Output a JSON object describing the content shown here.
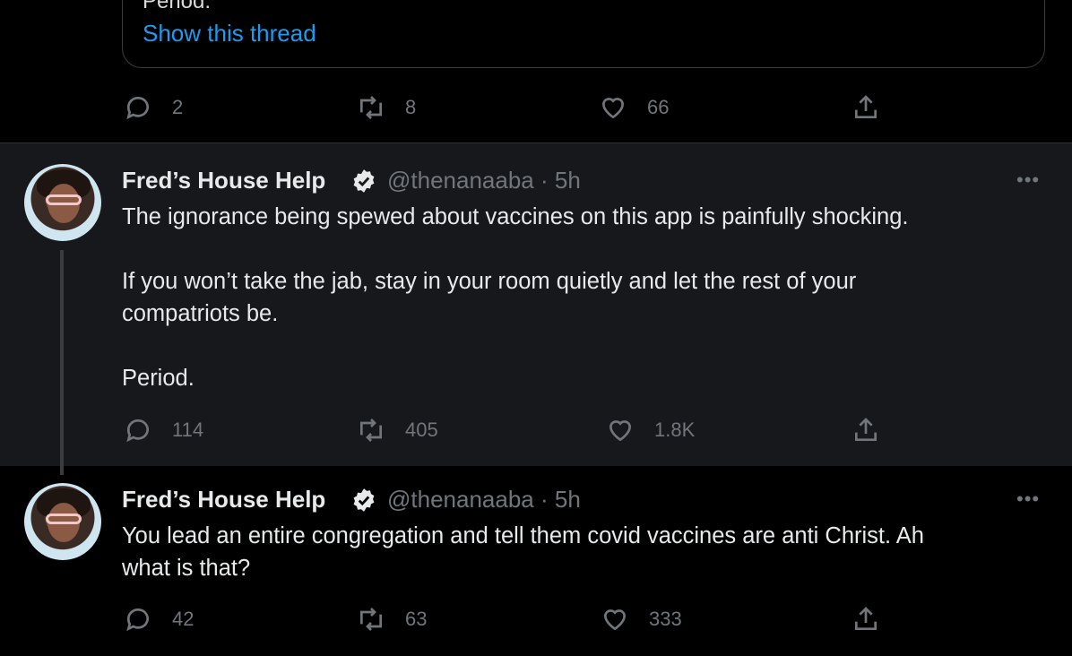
{
  "quoted": {
    "partial_text": "Period.",
    "show_thread": "Show this thread"
  },
  "top_actions": {
    "replies": "2",
    "retweets": "8",
    "likes": "66"
  },
  "tweets": [
    {
      "name": "Fred’s House Help",
      "handle": "@thenanaaba",
      "time": "· 5h",
      "more": "•••",
      "text": "The ignorance being spewed about vaccines on this app is painfully shocking.\n\nIf you won’t take the jab, stay in your room quietly and let the rest of your\ncompatriots be.\n\nPeriod.",
      "replies": "114",
      "retweets": "405",
      "likes": "1.8K"
    },
    {
      "name": "Fred’s House Help",
      "handle": "@thenanaaba",
      "time": "· 5h",
      "more": "•••",
      "text": "You lead an entire congregation and tell them covid vaccines are anti Christ. Ah\nwhat is that?",
      "replies": "42",
      "retweets": "63",
      "likes": "333"
    }
  ],
  "icons": {
    "reply": "reply-icon",
    "retweet": "retweet-icon",
    "like": "heart-icon",
    "share": "share-icon",
    "verified": "verified-badge-icon"
  },
  "colors": {
    "background": "#000000",
    "highlight": "#16181c",
    "link": "#1d9bf0",
    "muted": "#71767b"
  }
}
